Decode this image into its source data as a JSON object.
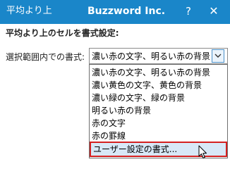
{
  "window": {
    "title": "平均より上",
    "app_title": "Buzzword Inc.",
    "help_label": "?",
    "close_label": "✕"
  },
  "dialog": {
    "heading": "平均より上のセルを書式設定:",
    "field_label": "選択範囲内での書式:"
  },
  "select": {
    "value": "濃い赤の文字、明るい赤の背景",
    "options": [
      "濃い赤の文字、明るい赤の背景",
      "濃い黄色の文字、黄色の背景",
      "濃い緑の文字、緑の背景",
      "明るい赤の背景",
      "赤の文字",
      "赤の罫線",
      "ユーザー設定の書式..."
    ],
    "highlighted_option": "ユーザー設定の書式..."
  },
  "colors": {
    "title_bar": "#1a86c9",
    "highlight_border": "#d42020",
    "highlight_fill": "#d8e8f7"
  },
  "icons": {
    "dropdown": "chevron-down-icon",
    "cursor": "mouse-pointer-icon"
  }
}
